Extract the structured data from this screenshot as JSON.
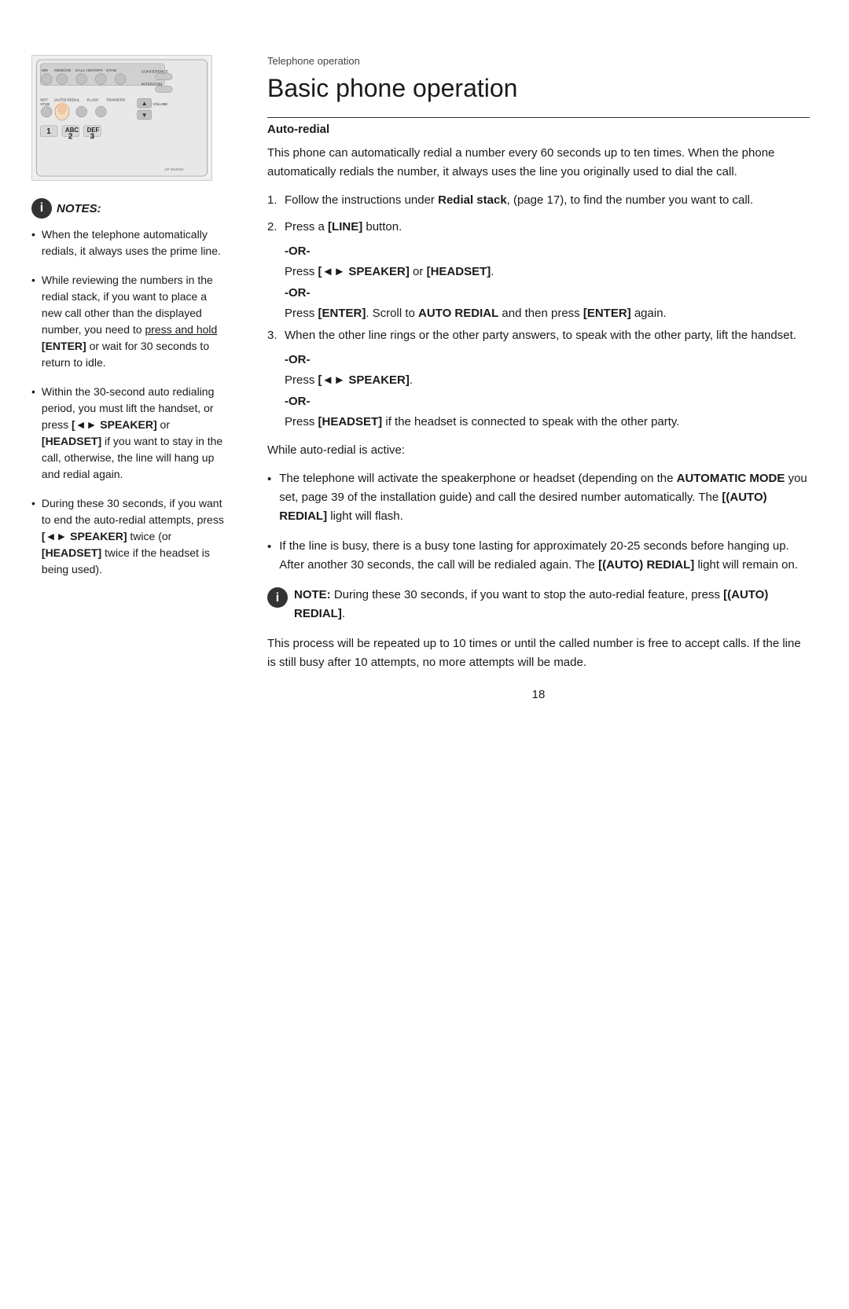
{
  "page": {
    "section_label": "Telephone operation",
    "main_title": "Basic phone operation",
    "subsection_title": "Auto-redial",
    "intro_text": "This phone can automatically redial a number every 60 seconds up to ten times. When the phone automatically redials the number, it always uses the line you originally used to dial the call.",
    "steps": [
      {
        "number": "1.",
        "text_parts": [
          {
            "text": "Follow the instructions under ",
            "bold": false
          },
          {
            "text": "Redial stack",
            "bold": true
          },
          {
            "text": ", (page 17), to find the number you want to call.",
            "bold": false
          }
        ]
      },
      {
        "number": "2.",
        "text_parts": [
          {
            "text": "Press a ",
            "bold": false
          },
          {
            "text": "[LINE]",
            "bold": true
          },
          {
            "text": " button.",
            "bold": false
          }
        ]
      },
      {
        "number": "3.",
        "text_parts": [
          {
            "text": "When the other line rings or the other party answers, to speak with the other party, lift the handset.",
            "bold": false
          }
        ]
      }
    ],
    "or_label": "-OR-",
    "step2_or1": "Press [◄► SPEAKER] or [HEADSET].",
    "step2_or2_pre": "Press ",
    "step2_or2_bold1": "[ENTER]",
    "step2_or2_mid": ". Scroll to ",
    "step2_or2_bold2": "AUTO REDIAL",
    "step2_or2_end": " and then press ",
    "step2_or2_bold3": "[ENTER]",
    "step2_or2_last": " again.",
    "step3_or1": "Press [◄► SPEAKER].",
    "step3_or2_pre": "Press ",
    "step3_or2_bold1": "[HEADSET]",
    "step3_or2_end": " if the headset is connected to speak with the other party.",
    "while_active_label": "While auto-redial is active:",
    "bullet_items": [
      {
        "parts": [
          {
            "text": "The telephone will activate the speakerphone or headset (depending on the ",
            "bold": false
          },
          {
            "text": "AUTOMATIC MODE",
            "bold": true
          },
          {
            "text": " you set, page 39 of the installation guide) and call the desired number automatically. The ",
            "bold": false
          },
          {
            "text": "[(AUTO) REDIAL]",
            "bold": true
          },
          {
            "text": " light will flash.",
            "bold": false
          }
        ]
      },
      {
        "parts": [
          {
            "text": "If the line is busy, there is a busy tone lasting for approximately 20-25 seconds before hanging up. After another 30 seconds, the call will be redialed again. The ",
            "bold": false
          },
          {
            "text": "[(AUTO) REDIAL]",
            "bold": true
          },
          {
            "text": " light will remain on.",
            "bold": false
          }
        ]
      }
    ],
    "note_block": {
      "pre": " NOTE: During these 30 seconds, if you want to stop the auto-redial feature, press ",
      "bold1": "[(AUTO) REDIAL]",
      "end": "."
    },
    "closing_text": "This process will be repeated up to 10 times or until the called number is free to accept calls. If the line is still busy after 10 attempts, no more attempts will be made.",
    "page_number": "18"
  },
  "left": {
    "notes_title": "NOTES:",
    "notes": [
      {
        "id": 1,
        "parts": [
          {
            "text": "When the telephone automatically redials, it always uses the prime line.",
            "bold": false,
            "underline": false
          }
        ]
      },
      {
        "id": 2,
        "parts": [
          {
            "text": "While reviewing the numbers in the redial stack, if you want to place a new call other than the displayed number, you need to ",
            "bold": false,
            "underline": false
          },
          {
            "text": "press and hold",
            "bold": false,
            "underline": true
          },
          {
            "text": " ",
            "bold": false,
            "underline": false
          },
          {
            "text": "[ENTER]",
            "bold": true,
            "underline": false
          },
          {
            "text": " or wait for 30 seconds to return to idle.",
            "bold": false,
            "underline": false
          }
        ]
      },
      {
        "id": 3,
        "parts": [
          {
            "text": "Within the 30-second auto redialing period, you must lift the handset, or press ",
            "bold": false,
            "underline": false
          },
          {
            "text": "[◄► SPEAKER]",
            "bold": true,
            "underline": false
          },
          {
            "text": " or ",
            "bold": false,
            "underline": false
          },
          {
            "text": "[HEADSET]",
            "bold": true,
            "underline": false
          },
          {
            "text": " if you want to stay in the call, otherwise, the line will hang up and redial again.",
            "bold": false,
            "underline": false
          }
        ]
      },
      {
        "id": 4,
        "parts": [
          {
            "text": "During these 30 seconds, if you want to end the auto-redial attempts, press ",
            "bold": false,
            "underline": false
          },
          {
            "text": "[◄► SPEAKER]",
            "bold": true,
            "underline": false
          },
          {
            "text": " twice (or ",
            "bold": false,
            "underline": false
          },
          {
            "text": "[HEADSET]",
            "bold": true,
            "underline": false
          },
          {
            "text": " twice if the headset is being used).",
            "bold": false,
            "underline": false
          }
        ]
      }
    ]
  }
}
